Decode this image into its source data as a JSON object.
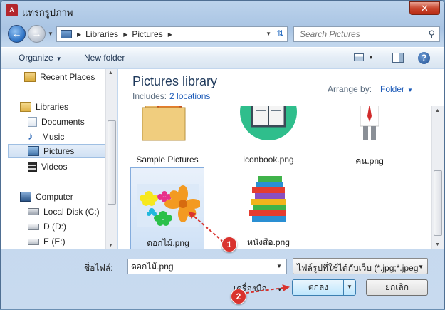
{
  "window": {
    "title": "แทรกรูปภาพ",
    "close_label": "✕"
  },
  "address": {
    "crumbs": [
      "Libraries",
      "Pictures"
    ],
    "search_placeholder": "Search Pictures"
  },
  "toolbar": {
    "organize": "Organize",
    "new_folder": "New folder"
  },
  "nav": {
    "items": [
      {
        "label": "Recent Places",
        "icon": "recent-places-icon"
      },
      {
        "label": "Libraries",
        "icon": "libraries-folder-icon"
      },
      {
        "label": "Documents",
        "icon": "documents-icon"
      },
      {
        "label": "Music",
        "icon": "music-icon"
      },
      {
        "label": "Pictures",
        "icon": "pictures-icon",
        "selected": true
      },
      {
        "label": "Videos",
        "icon": "videos-icon"
      },
      {
        "label": "Computer",
        "icon": "computer-icon"
      },
      {
        "label": "Local Disk (C:)",
        "icon": "local-disk-icon"
      },
      {
        "label": "D (D:)",
        "icon": "drive-icon"
      },
      {
        "label": "E (E:)",
        "icon": "drive-icon"
      }
    ]
  },
  "library": {
    "title": "Pictures library",
    "includes_label": "Includes:",
    "includes_link": "2 locations",
    "arrange_label": "Arrange by:",
    "arrange_value": "Folder"
  },
  "files": [
    {
      "name": "Sample Pictures",
      "kind": "folder"
    },
    {
      "name": "iconbook.png",
      "kind": "book"
    },
    {
      "name": "คน.png",
      "kind": "person"
    },
    {
      "name": "ดอกไม้.png",
      "kind": "flowers",
      "selected": true
    },
    {
      "name": "หนังสือ.png",
      "kind": "books-stack"
    }
  ],
  "bottom": {
    "filename_label": "ชื่อไฟล์:",
    "filename_value": "ดอกไม้.png",
    "filetype_value": "ไฟล์รูปที่ใช้ได้กับเว็บ (*.jpg;*.jpeg",
    "tools_label": "เครื่องมือ",
    "ok_label": "ตกลง",
    "cancel_label": "ยกเลิก"
  },
  "annotations": {
    "step1": "1",
    "step2": "2",
    "color": "#d9332e"
  }
}
